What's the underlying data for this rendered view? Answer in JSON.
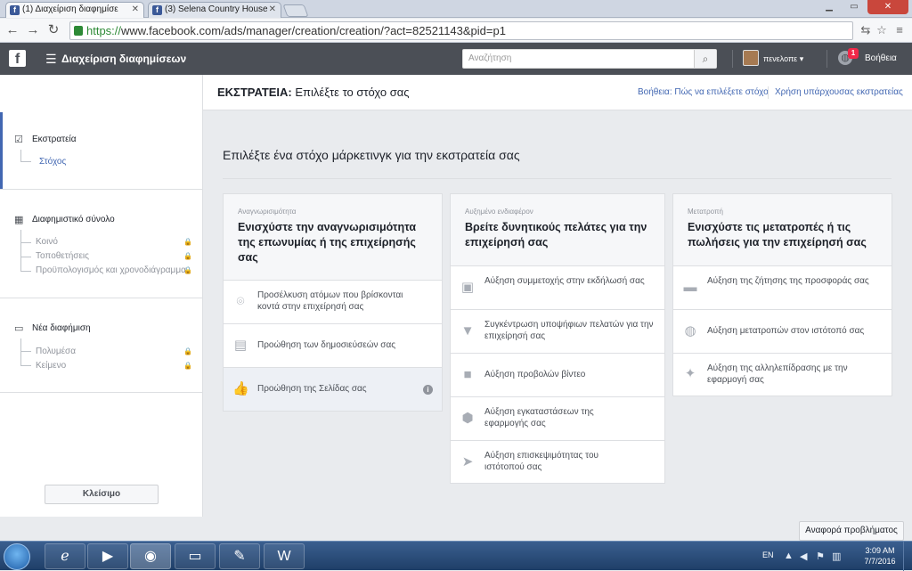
{
  "browser": {
    "tabs": [
      {
        "label": "(1) Διαχείριση διαφημίσε"
      },
      {
        "label": "(3) Selena Country House"
      }
    ],
    "url_https": "https://",
    "url_rest": "www.facebook.com/ads/manager/creation/creation/?act=82521143&pid=p1"
  },
  "fbbar": {
    "logo": "f",
    "title": "Διαχείριση διαφημίσεων",
    "search_placeholder": "Αναζήτηση",
    "user": "πενελοπε",
    "notifications": "1",
    "help": "Βοήθεια"
  },
  "header": {
    "campaign_prefix": "ΕΚΣΤΡΑΤΕΙΑ:",
    "campaign_text": " Επιλέξτε το στόχο σας",
    "help_link": "Βοήθεια: Πώς να επιλέξετε στόχο",
    "use_existing_link": "Χρήση υπάρχουσας εκστρατείας"
  },
  "sidebar": {
    "campaign": {
      "title": "Εκστρατεία",
      "items": [
        "Στόχος"
      ]
    },
    "adset": {
      "title": "Διαφημιστικό σύνολο",
      "items": [
        "Κοινό",
        "Τοποθετήσεις",
        "Προϋπολογισμός και χρονοδιάγραμμα"
      ]
    },
    "ad": {
      "title": "Νέα διαφήμιση",
      "items": [
        "Πολυμέσα",
        "Κείμενο"
      ]
    },
    "close_button": "Κλείσιμο"
  },
  "main": {
    "title": "Επιλέξτε ένα στόχο μάρκετινγκ για την εκστρατεία σας",
    "columns": [
      {
        "category": "Αναγνωρισιμότητα",
        "title": "Ενισχύστε την αναγνωρισιμότητα της επωνυμίας ή της επιχείρησής σας",
        "options": [
          {
            "label": "Προσέλκυση ατόμων που βρίσκονται κοντά στην επιχείρησή σας",
            "icon": "location-pin-icon"
          },
          {
            "label": "Προώθηση των δημοσιεύσεών σας",
            "icon": "posts-icon"
          },
          {
            "label": "Προώθηση της Σελίδας σας",
            "icon": "thumbs-up-icon"
          }
        ]
      },
      {
        "category": "Αυξημένο ενδιαφέρον",
        "title": "Βρείτε δυνητικούς πελάτες για την επιχείρησή σας",
        "options": [
          {
            "label": "Αύξηση συμμετοχής στην εκδήλωσή σας",
            "icon": "calendar-icon"
          },
          {
            "label": "Συγκέντρωση υποψήφιων πελατών για την επιχείρησή σας",
            "icon": "funnel-icon"
          },
          {
            "label": "Αύξηση προβολών βίντεο",
            "icon": "video-camera-icon"
          },
          {
            "label": "Αύξηση εγκαταστάσεων της εφαρμογής σας",
            "icon": "cube-icon"
          },
          {
            "label": "Αύξηση επισκεψιμότητας του ιστότοπού σας",
            "icon": "cursor-icon"
          }
        ]
      },
      {
        "category": "Μετατροπή",
        "title": "Ενισχύστε τις μετατροπές ή τις πωλήσεις για την επιχείρησή σας",
        "options": [
          {
            "label": "Αύξηση της ζήτησης της προσφοράς σας",
            "icon": "store-icon"
          },
          {
            "label": "Αύξηση μετατροπών στον ιστότοπό σας",
            "icon": "globe-icon"
          },
          {
            "label": "Αύξηση της αλληλεπίδρασης με την εφαρμογή σας",
            "icon": "gamepad-icon"
          }
        ]
      }
    ]
  },
  "report_button": "Αναφορά προβλήματος",
  "taskbar": {
    "lang": "EN",
    "time": "3:09 AM",
    "date": "7/7/2016"
  },
  "colors": {
    "fb_bar": "#4b4f56",
    "link": "#4267b2",
    "accent": "#4267b2"
  }
}
